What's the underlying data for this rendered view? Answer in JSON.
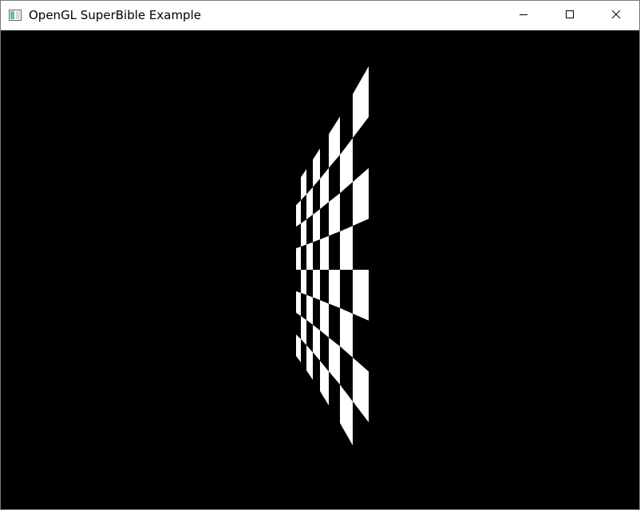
{
  "window": {
    "title": "OpenGL SuperBible Example",
    "app_icon": "opengl-app-icon",
    "controls": {
      "minimize_icon": "minimize-icon",
      "maximize_icon": "maximize-icon",
      "close_icon": "close-icon"
    }
  },
  "scene": {
    "background_color": "#000000",
    "checker_light": "#ffffff",
    "checker_dark": "#000000",
    "description_icon": "perspective-checkerboard"
  }
}
